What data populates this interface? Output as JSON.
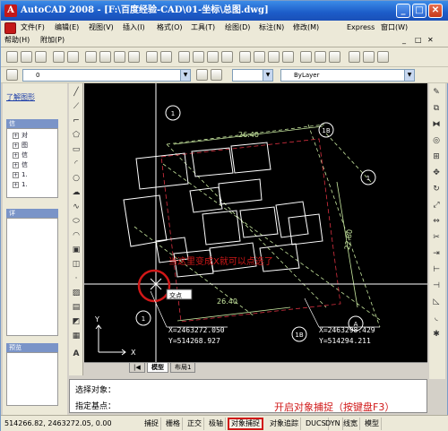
{
  "window": {
    "app_icon": "A",
    "title": "AutoCAD 2008 - [F:\\百度经验-CAD\\01-坐标\\总图.dwg]",
    "buttons": [
      "_",
      "□",
      "✕"
    ],
    "doc_buttons": [
      "_",
      "□",
      "✕"
    ]
  },
  "menubar": {
    "items": [
      "文件(F)",
      "编辑(E)",
      "视图(V)",
      "插入(I)",
      "格式(O)",
      "工具(T)",
      "绘图(D)",
      "标注(N)",
      "修改(M)",
      "Express",
      "窗口(W)"
    ],
    "row2": [
      "帮助(H)",
      "附加(P)"
    ]
  },
  "toolbar": {
    "layer_value": "0",
    "linetype_value": "ByLayer"
  },
  "panels": {
    "link_text": "了解图形",
    "tree_items": [
      "对",
      "图",
      "信",
      "信",
      "1.",
      "1."
    ],
    "panel2_title": "详",
    "panel3_title": "预览",
    "panel1_title": "信"
  },
  "canvas": {
    "dims": [
      "26.40",
      "26.40",
      "22.80"
    ],
    "circles": [
      "1",
      "1B",
      "1",
      "A",
      "1",
      "1B",
      "A"
    ],
    "snap_tooltip": "交点",
    "coord_left": [
      "X=2463272.050",
      "Y=514268.927"
    ],
    "coord_right": [
      "X=2463298.429",
      "Y=514294.211"
    ],
    "ucs_x": "X",
    "ucs_y": "Y",
    "annotation": "当这里变成X就可以点选了",
    "tabs": [
      "模型",
      "布局1"
    ]
  },
  "command": {
    "line1": "选择对象：",
    "line2": "指定基点：",
    "hint": "开启对象捕捉（按键盘F3）"
  },
  "status": {
    "coords": "514266.82, 2463272.05, 0.00",
    "buttons": [
      "捕捉",
      "栅格",
      "正交",
      "极轴",
      "对象捕捉",
      "对象追踪",
      "DUCS",
      "DYN",
      "线宽",
      "模型"
    ],
    "highlight_index": 4
  },
  "colors": {
    "annotation": "#d01818",
    "building": "#ffffff",
    "dashed_grid": "#c8e8a0",
    "cursor": "#ffffff"
  }
}
